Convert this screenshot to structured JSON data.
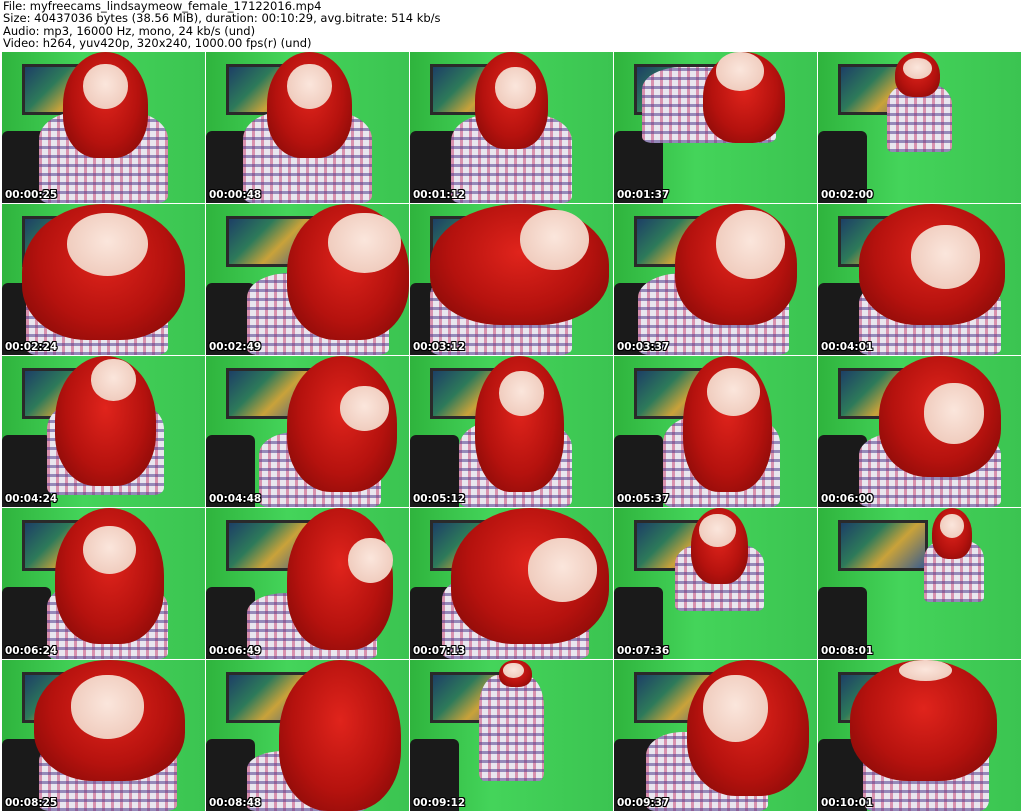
{
  "header": {
    "file_line": "File: myfreecams_lindsaymeow_female_17122016.mp4",
    "size_line": "Size: 40437036 bytes (38.56 MiB), duration: 00:10:29, avg.bitrate: 514 kb/s",
    "audio_line": "Audio: mp3, 16000 Hz, mono, 24 kb/s (und)",
    "video_line": "Video: h264, yuv420p, 320x240, 1000.00 fps(r) (und)"
  },
  "thumbnails": [
    {
      "timestamp": "00:00:25"
    },
    {
      "timestamp": "00:00:48"
    },
    {
      "timestamp": "00:01:12"
    },
    {
      "timestamp": "00:01:37"
    },
    {
      "timestamp": "00:02:00"
    },
    {
      "timestamp": "00:02:24"
    },
    {
      "timestamp": "00:02:49"
    },
    {
      "timestamp": "00:03:12"
    },
    {
      "timestamp": "00:03:37"
    },
    {
      "timestamp": "00:04:01"
    },
    {
      "timestamp": "00:04:24"
    },
    {
      "timestamp": "00:04:48"
    },
    {
      "timestamp": "00:05:12"
    },
    {
      "timestamp": "00:05:37"
    },
    {
      "timestamp": "00:06:00"
    },
    {
      "timestamp": "00:06:24"
    },
    {
      "timestamp": "00:06:49"
    },
    {
      "timestamp": "00:07:13"
    },
    {
      "timestamp": "00:07:36"
    },
    {
      "timestamp": "00:08:01"
    },
    {
      "timestamp": "00:08:25"
    },
    {
      "timestamp": "00:08:48"
    },
    {
      "timestamp": "00:09:12"
    },
    {
      "timestamp": "00:09:37"
    },
    {
      "timestamp": "00:10:01"
    }
  ],
  "colors": {
    "background": "#ffffff",
    "header_text": "#000000",
    "timestamp_text": "#ffffff",
    "wall_green": "#3bc451",
    "hair_red": "#c8150f"
  }
}
